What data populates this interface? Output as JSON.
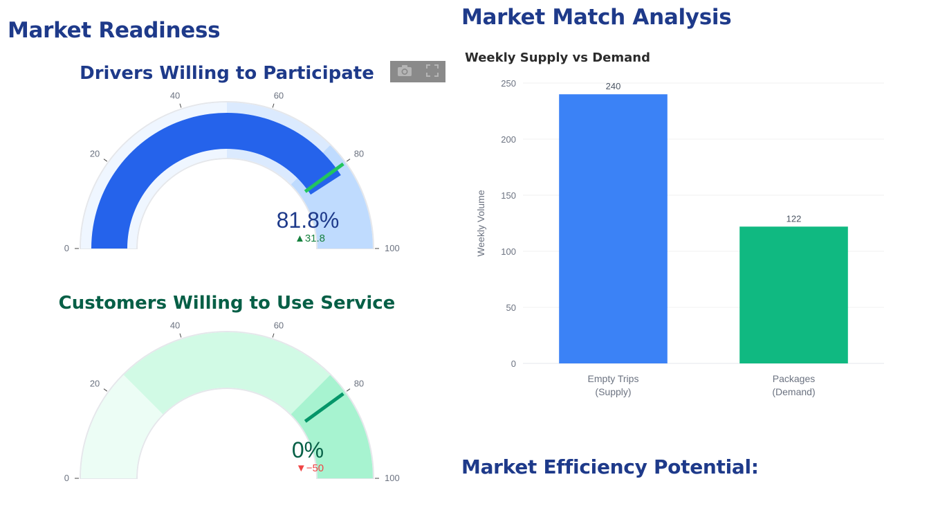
{
  "left": {
    "heading": "Market Readiness",
    "gauges": [
      {
        "title": "Drivers Willing to Participate",
        "title_color": "#1e3a8a",
        "value": 81.8,
        "value_text": "81.8%",
        "value_color": "#1e3a8a",
        "delta_text": "▲31.8",
        "delta_color": "#15803d",
        "threshold": 80,
        "threshold_color": "#22c55e",
        "bar_color": "#2563eb",
        "range_min": 0,
        "range_max": 100,
        "steps": [
          {
            "from": 0,
            "to": 50,
            "color": "#eff6ff"
          },
          {
            "from": 50,
            "to": 75,
            "color": "#dbeafe"
          },
          {
            "from": 75,
            "to": 100,
            "color": "#bfdbfe"
          }
        ],
        "ticks": [
          "0",
          "20",
          "40",
          "60",
          "80",
          "100"
        ]
      },
      {
        "title": "Customers Willing to Use Service",
        "title_color": "#065f46",
        "value": 0,
        "value_text": "0%",
        "value_color": "#065f46",
        "delta_text": "▼−50",
        "delta_color": "#ef4444",
        "threshold": 80,
        "threshold_color": "#059669",
        "bar_color": "#10b981",
        "range_min": 0,
        "range_max": 100,
        "steps": [
          {
            "from": 0,
            "to": 25,
            "color": "#ecfdf5"
          },
          {
            "from": 25,
            "to": 75,
            "color": "#d1fae5"
          },
          {
            "from": 75,
            "to": 100,
            "color": "#a7f3d0"
          }
        ],
        "ticks": [
          "0",
          "20",
          "40",
          "60",
          "80",
          "100"
        ]
      }
    ],
    "modebar": [
      "camera-icon",
      "fullscreen-icon"
    ]
  },
  "right": {
    "heading": "Market Match Analysis",
    "subheading": "Market Efficiency Potential:"
  },
  "chart_data": {
    "type": "bar",
    "title": "Weekly Supply vs Demand",
    "xlabel": "",
    "ylabel": "Weekly Volume",
    "categories": [
      "Empty Trips (Supply)",
      "Packages (Demand)"
    ],
    "category_lines": [
      [
        "Empty Trips",
        "(Supply)"
      ],
      [
        "Packages",
        "(Demand)"
      ]
    ],
    "values": [
      240,
      122
    ],
    "data_labels": [
      "240",
      "122"
    ],
    "colors": [
      "#3b82f6",
      "#10b981"
    ],
    "ylim": [
      0,
      250
    ],
    "yticks": [
      "0",
      "50",
      "100",
      "150",
      "200",
      "250"
    ],
    "grid": true
  }
}
